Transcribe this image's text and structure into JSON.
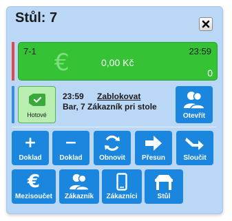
{
  "dialog": {
    "title": "Stůl: 7"
  },
  "order": {
    "id": "7-1",
    "time": "23:59",
    "amount": "0,00 Kč",
    "count": "0"
  },
  "activity": {
    "done_label": "Hotové",
    "time": "23:59",
    "action": "Zablokovat",
    "description": "Bar, 7 Zákazník pri stole",
    "open_label": "Otevřít"
  },
  "buttons": {
    "doklad_plus": "Doklad",
    "doklad_minus": "Doklad",
    "obnovit": "Obnovit",
    "presun": "Přesun",
    "sloucit": "Sloučit",
    "mezisoucet": "Mezisoučet",
    "zakaznik": "Zákazník",
    "zakaznici": "Zákazníci",
    "stul": "Stůl"
  },
  "colors": {
    "panel": "#bad7f6",
    "button": "#1a86dd",
    "order": "#35c235",
    "done": "#b8eeb0"
  }
}
